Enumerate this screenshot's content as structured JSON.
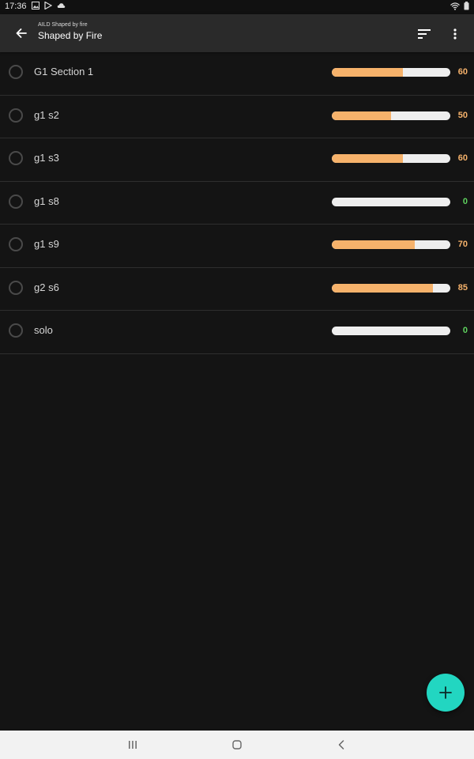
{
  "status_bar": {
    "time": "17:36",
    "left_icons": [
      "image-icon",
      "play-store-icon",
      "cloud-icon"
    ],
    "right_icons": [
      "wifi-icon",
      "battery-icon"
    ]
  },
  "app_bar": {
    "subtitle": "AILD Shaped by fire",
    "title": "Shaped by Fire",
    "icons": [
      "back-arrow-icon",
      "sort-icon",
      "more-vert-icon"
    ]
  },
  "colors": {
    "background": "#141414",
    "app_bar": "#2a2a2a",
    "bar_fill": "#f6b26b",
    "bar_track": "#eeeeee",
    "value_orange": "#f6b26b",
    "value_green": "#5fd35f",
    "fab": "#22d6c1"
  },
  "items": [
    {
      "label": "G1 Section 1",
      "value": "60",
      "progress": 0.6
    },
    {
      "label": "g1 s2",
      "value": "50",
      "progress": 0.5
    },
    {
      "label": "g1 s3",
      "value": "60",
      "progress": 0.6
    },
    {
      "label": "g1 s8",
      "value": "0",
      "progress": 0.0
    },
    {
      "label": "g1 s9",
      "value": "70",
      "progress": 0.7
    },
    {
      "label": "g2 s6",
      "value": "85",
      "progress": 0.85
    },
    {
      "label": "solo",
      "value": "0",
      "progress": 0.0
    }
  ],
  "fab": {
    "icon": "plus-icon"
  },
  "nav_bar": {
    "icons": [
      "recents-icon",
      "home-icon",
      "back-icon"
    ]
  }
}
